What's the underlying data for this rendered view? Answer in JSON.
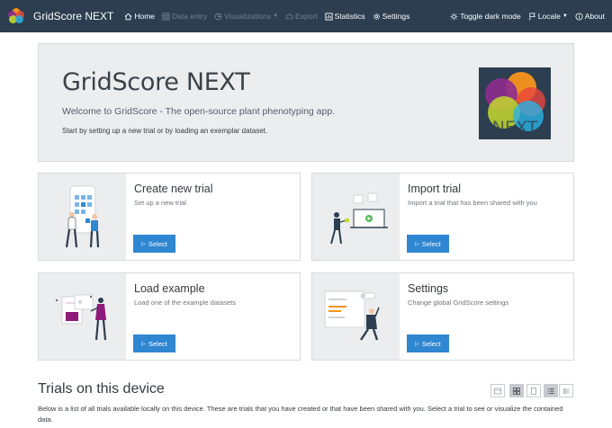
{
  "navbar": {
    "brand": "GridScore NEXT",
    "items": [
      {
        "label": "Home",
        "icon": "home-icon",
        "enabled": true
      },
      {
        "label": "Data entry",
        "icon": "grid-icon",
        "enabled": false
      },
      {
        "label": "Visualizations",
        "icon": "chart-icon",
        "enabled": false
      },
      {
        "label": "Export",
        "icon": "cloud-upload-icon",
        "enabled": false
      },
      {
        "label": "Statistics",
        "icon": "statistics-icon",
        "enabled": true
      },
      {
        "label": "Settings",
        "icon": "gear-icon",
        "enabled": true
      }
    ],
    "right": {
      "dark_mode": "Toggle dark mode",
      "locale": "Locale",
      "about": "About"
    }
  },
  "jumbotron": {
    "title": "GridScore NEXT",
    "lead": "Welcome to GridScore - The open-source plant phenotyping app.",
    "subtext": "Start by setting up a new trial or by loading an exemplar dataset.",
    "logo_text": "NEXT"
  },
  "cards": [
    {
      "title": "Create new trial",
      "subtitle": "Set up a new trial",
      "button": "Select"
    },
    {
      "title": "Import trial",
      "subtitle": "Import a trial that has been shared with you",
      "button": "Select"
    },
    {
      "title": "Load example",
      "subtitle": "Load one of the example datasets",
      "button": "Select"
    },
    {
      "title": "Settings",
      "subtitle": "Change global GridScore settings",
      "button": "Select"
    }
  ],
  "trials": {
    "title": "Trials on this device",
    "description": "Below is a list of all trials available locally on this device. These are trials that you have created or that have been shared with you. Select a trial to see or visualize the contained data."
  },
  "colors": {
    "navbar": "#2c3e50",
    "accent": "#2f86d1",
    "jumbotron": "#ecedef"
  }
}
